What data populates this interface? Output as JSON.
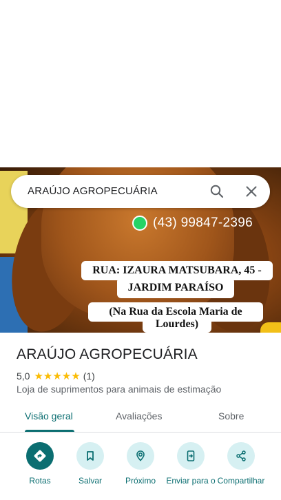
{
  "search": {
    "query": "ARAÚJO AGROPECUÁRIA"
  },
  "hero": {
    "phone": "(43) 99847-2396",
    "address_line1": "RUA: IZAURA MATSUBARA, 45 -",
    "address_line2": "JARDIM PARAÍSO",
    "note_line1": "(Na Rua da Escola Maria de",
    "note_line2": "Lourdes)"
  },
  "place": {
    "name": "ARAÚJO AGROPECUÁRIA",
    "rating": "5,0",
    "rating_value": 5.0,
    "stars": "★★★★★",
    "review_count": "(1)",
    "category": "Loja de suprimentos para animais de estimação"
  },
  "tabs": [
    {
      "label": "Visão geral",
      "active": true
    },
    {
      "label": "Avaliações",
      "active": false
    },
    {
      "label": "Sobre",
      "active": false
    }
  ],
  "actions": [
    {
      "label": "Rotas",
      "icon": "directions-icon"
    },
    {
      "label": "Salvar",
      "icon": "bookmark-icon"
    },
    {
      "label": "Próximo",
      "icon": "nearby-icon"
    },
    {
      "label": "Enviar para o",
      "icon": "send-to-phone-icon"
    },
    {
      "label": "Compartilhar",
      "icon": "share-icon"
    }
  ],
  "colors": {
    "accent": "#0b6e71",
    "accent_light": "#d6f0f2",
    "star": "#fbbc04",
    "whatsapp": "#25d366"
  }
}
